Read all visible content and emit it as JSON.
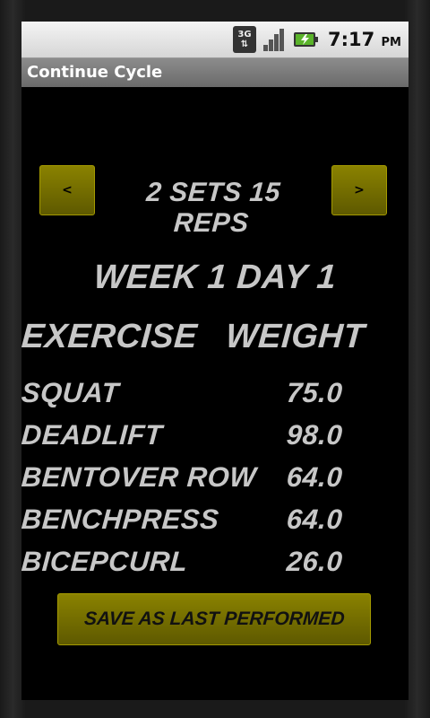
{
  "status_bar": {
    "network_top": "3G",
    "network_bottom": "⇅",
    "time": "7:17",
    "ampm": "PM"
  },
  "app": {
    "title": "Continue Cycle"
  },
  "navigation": {
    "prev_label": "<",
    "next_label": ">",
    "sets_reps": "2 SETS 15 REPS"
  },
  "workout": {
    "week_day": "WEEK 1 DAY 1",
    "header_exercise": "EXERCISE",
    "header_weight": "WEIGHT",
    "rows": [
      {
        "name": "SQUAT",
        "weight": "75.0"
      },
      {
        "name": "DEADLIFT",
        "weight": "98.0"
      },
      {
        "name": "BENTOVER ROW",
        "weight": "64.0"
      },
      {
        "name": "BENCHPRESS",
        "weight": "64.0"
      },
      {
        "name": "BICEPCURL",
        "weight": "26.0"
      }
    ]
  },
  "actions": {
    "save_label": "SAVE AS LAST PERFORMED"
  },
  "colors": {
    "accent": "#7a7300",
    "text": "#c7c7c7",
    "background": "#000000"
  }
}
